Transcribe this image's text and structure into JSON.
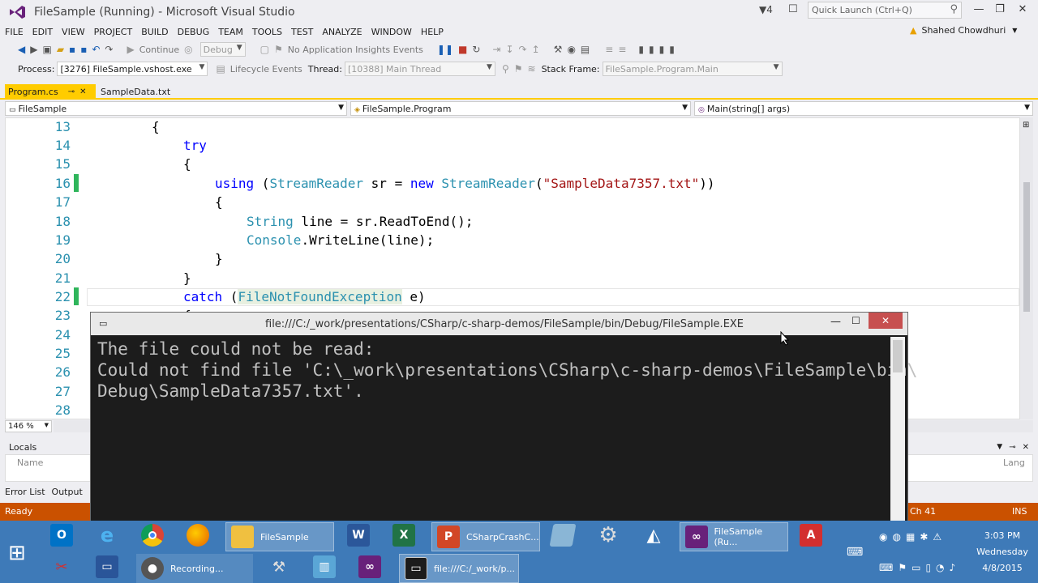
{
  "window": {
    "title": "FileSample (Running) - Microsoft Visual Studio",
    "notification_count": "4",
    "quick_launch_placeholder": "Quick Launch (Ctrl+Q)",
    "user": "Shahed Chowdhuri"
  },
  "menu": [
    "FILE",
    "EDIT",
    "VIEW",
    "PROJECT",
    "BUILD",
    "DEBUG",
    "TEAM",
    "TOOLS",
    "TEST",
    "ANALYZE",
    "WINDOW",
    "HELP"
  ],
  "toolbar1": {
    "continue_label": "Continue",
    "config": "Debug",
    "insights": "No Application Insights Events"
  },
  "toolbar2": {
    "process_label": "Process:",
    "process_value": "[3276] FileSample.vshost.exe",
    "lifecycle_label": "Lifecycle Events",
    "thread_label": "Thread:",
    "thread_value": "[10388] Main Thread",
    "stackframe_label": "Stack Frame:",
    "stackframe_value": "FileSample.Program.Main"
  },
  "tabs": {
    "active": "Program.cs",
    "other": "SampleData.txt"
  },
  "navbar": {
    "project": "FileSample",
    "type": "FileSample.Program",
    "member": "Main(string[] args)"
  },
  "editor": {
    "line_numbers": [
      "13",
      "14",
      "15",
      "16",
      "17",
      "18",
      "19",
      "20",
      "21",
      "22",
      "23",
      "24",
      "25",
      "26",
      "27",
      "28"
    ],
    "zoom": "146 %"
  },
  "locals": {
    "title": "Locals",
    "col_name": "Name",
    "col_lang": "Lang"
  },
  "bottom_tabs": [
    "Error List",
    "Output"
  ],
  "status": {
    "left": "Ready",
    "col": "Ch 41",
    "mode": "INS"
  },
  "console": {
    "title": "file:///C:/_work/presentations/CSharp/c-sharp-demos/FileSample/bin/Debug/FileSample.EXE",
    "lines": [
      "The file could not be read:",
      "Could not find file 'C:\\_work\\presentations\\CSharp\\c-sharp-demos\\FileSample\\bin\\",
      "Debug\\SampleData7357.txt'."
    ]
  },
  "taskbar": {
    "filesample_explorer": "FileSample",
    "powerpoint": "CSharpCrashC...",
    "vs_running": "FileSample (Ru...",
    "recording": "Recording...",
    "console_task": "file:///C:/_work/p...",
    "time": "3:03 PM",
    "day": "Wednesday",
    "date": "4/8/2015"
  }
}
